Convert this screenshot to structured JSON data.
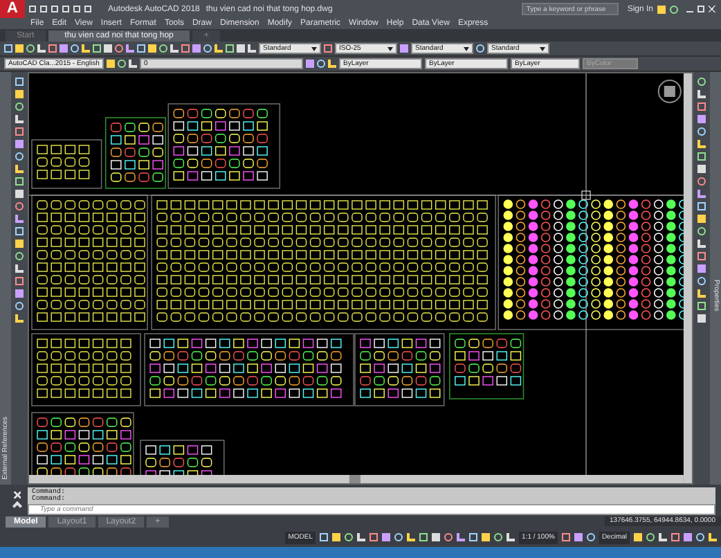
{
  "title_bar": {
    "logo": "A",
    "title": "Autodesk AutoCAD 2018",
    "file": "thu vien cad noi that tong hop.dwg",
    "search": {
      "placeholder": "Type a keyword or phrase"
    },
    "sign_in": "Sign In"
  },
  "menu": [
    "File",
    "Edit",
    "View",
    "Insert",
    "Format",
    "Tools",
    "Draw",
    "Dimension",
    "Modify",
    "Parametric",
    "Window",
    "Help",
    "Data View",
    "Express"
  ],
  "file_tabs": [
    {
      "label": "Start",
      "selected": false
    },
    {
      "label": "thu vien cad noi that tong hop",
      "selected": true
    }
  ],
  "new_tab": "+",
  "toolbar_dropdowns": [
    "Standard",
    "ISO-25",
    "Standard",
    "Standard"
  ],
  "workspace": "AutoCAD Cla...2015 - English",
  "layer": "0",
  "properties": [
    {
      "label": "ByLayer",
      "disabled": false
    },
    {
      "label": "ByLayer",
      "disabled": false
    },
    {
      "label": "ByLayer",
      "disabled": false
    },
    {
      "label": "ByColor",
      "disabled": true
    }
  ],
  "palettes": {
    "left": "External References",
    "right": "Properties"
  },
  "command": {
    "history": [
      "Command:",
      "Command:"
    ],
    "placeholder": "Type a command"
  },
  "layout_tabs": [
    {
      "label": "Model",
      "selected": true
    },
    {
      "label": "Layout1",
      "selected": false
    },
    {
      "label": "Layout2",
      "selected": false
    }
  ],
  "new_layout": "+",
  "coordinates": "137646.3755, 64944.8634, 0.0000",
  "status": {
    "model": "MODEL",
    "scale": "1:1 / 100%",
    "units": "Decimal"
  }
}
